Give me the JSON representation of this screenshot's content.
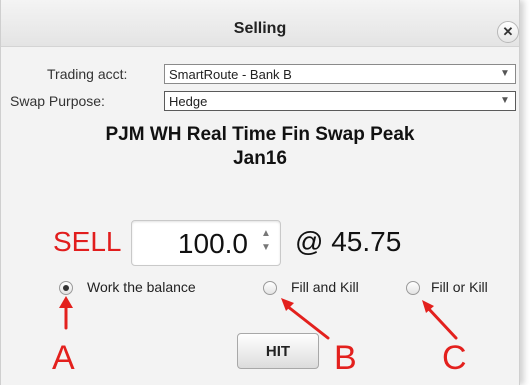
{
  "dialog": {
    "title": "Selling",
    "close_icon": "close-icon"
  },
  "form": {
    "trading_acct_label": "Trading acct:",
    "trading_acct_value": "SmartRoute - Bank B",
    "swap_purpose_label": "Swap Purpose:",
    "swap_purpose_value": "Hedge"
  },
  "product": {
    "line1": "PJM WH Real Time Fin Swap Peak",
    "line2": "Jan16"
  },
  "order": {
    "side": "SELL",
    "quantity": "100.0",
    "price": "@ 45.75"
  },
  "execution_options": [
    {
      "label": "Work the balance",
      "selected": true
    },
    {
      "label": "Fill and Kill",
      "selected": false
    },
    {
      "label": "Fill or Kill",
      "selected": false
    }
  ],
  "hit_button": "HIT",
  "annotations": [
    "A",
    "B",
    "C"
  ],
  "colors": {
    "sell": "#e11d1d",
    "annotation": "#e3201d"
  }
}
